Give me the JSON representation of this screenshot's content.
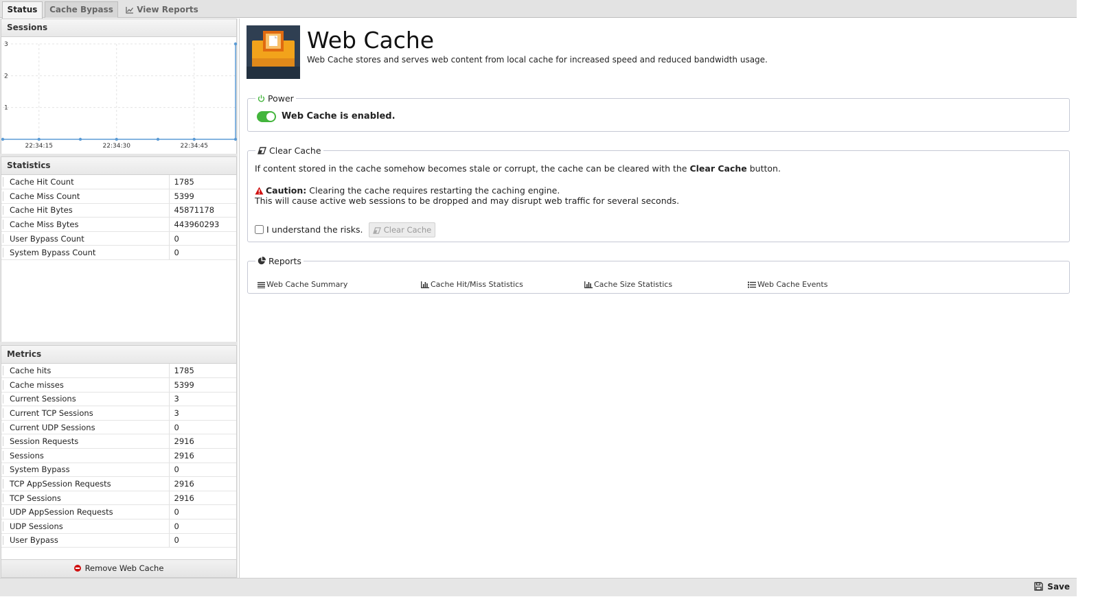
{
  "tabs": [
    {
      "label": "Status"
    },
    {
      "label": "Cache Bypass"
    },
    {
      "label": "View Reports"
    }
  ],
  "sessions_panel": {
    "title": "Sessions"
  },
  "chart_data": {
    "type": "line",
    "title": "",
    "x_ticks": [
      "22:34:15",
      "22:34:30",
      "22:34:45"
    ],
    "y_ticks": [
      1,
      2,
      3
    ],
    "ylim": [
      0,
      3
    ],
    "series": [
      {
        "points": [
          {
            "x": "22:34:08",
            "y": 0
          },
          {
            "x": "22:34:15",
            "y": 0
          },
          {
            "x": "22:34:23",
            "y": 0
          },
          {
            "x": "22:34:30",
            "y": 0
          },
          {
            "x": "22:34:38",
            "y": 0
          },
          {
            "x": "22:34:45",
            "y": 0
          },
          {
            "x": "22:34:53",
            "y": 0
          },
          {
            "x": "22:34:53",
            "y": 3
          }
        ]
      }
    ],
    "line_color": "#5b9bd5",
    "grid": true
  },
  "statistics": {
    "title": "Statistics",
    "rows": [
      {
        "label": "Cache Hit Count",
        "value": "1785"
      },
      {
        "label": "Cache Miss Count",
        "value": "5399"
      },
      {
        "label": "Cache Hit Bytes",
        "value": "45871178"
      },
      {
        "label": "Cache Miss Bytes",
        "value": "443960293"
      },
      {
        "label": "User Bypass Count",
        "value": "0"
      },
      {
        "label": "System Bypass Count",
        "value": "0"
      }
    ]
  },
  "metrics": {
    "title": "Metrics",
    "rows": [
      {
        "label": "Cache hits",
        "value": "1785"
      },
      {
        "label": "Cache misses",
        "value": "5399"
      },
      {
        "label": "Current Sessions",
        "value": "3"
      },
      {
        "label": "Current TCP Sessions",
        "value": "3"
      },
      {
        "label": "Current UDP Sessions",
        "value": "0"
      },
      {
        "label": "Session Requests",
        "value": "2916"
      },
      {
        "label": "Sessions",
        "value": "2916"
      },
      {
        "label": "System Bypass",
        "value": "0"
      },
      {
        "label": "TCP AppSession Requests",
        "value": "2916"
      },
      {
        "label": "TCP Sessions",
        "value": "2916"
      },
      {
        "label": "UDP AppSession Requests",
        "value": "0"
      },
      {
        "label": "UDP Sessions",
        "value": "0"
      },
      {
        "label": "User Bypass",
        "value": "0"
      }
    ]
  },
  "remove_button": {
    "label": "Remove Web Cache",
    "icon": "minus-circle-icon",
    "color": "#d01010"
  },
  "app": {
    "title": "Web Cache",
    "description": "Web Cache stores and serves web content from local cache for increased speed and reduced bandwidth usage.",
    "icon": "web-cache-icon"
  },
  "power": {
    "legend": "Power",
    "status_text": "Web Cache is enabled.",
    "enabled": true,
    "toggle_color": "#43b53c"
  },
  "clear_cache": {
    "legend": "Clear Cache",
    "intro_before": "If content stored in the cache somehow becomes stale or corrupt, the cache can be cleared with the ",
    "intro_bold": "Clear Cache",
    "intro_after": " button.",
    "caution_label": "Caution:",
    "caution_text": " Clearing the cache requires restarting the caching engine.",
    "caution_line2": "This will cause active web sessions to be dropped and may disrupt web traffic for several seconds.",
    "checkbox_label": "I understand the risks.",
    "checkbox_checked": false,
    "button_label": "Clear Cache"
  },
  "reports": {
    "legend": "Reports",
    "links": [
      {
        "label": "Web Cache Summary",
        "icon": "align-justify-icon"
      },
      {
        "label": "Cache Hit/Miss Statistics",
        "icon": "bar-chart-icon"
      },
      {
        "label": "Cache Size Statistics",
        "icon": "bar-chart-icon"
      },
      {
        "label": "Web Cache Events",
        "icon": "list-icon"
      }
    ]
  },
  "footer": {
    "save_label": "Save"
  }
}
